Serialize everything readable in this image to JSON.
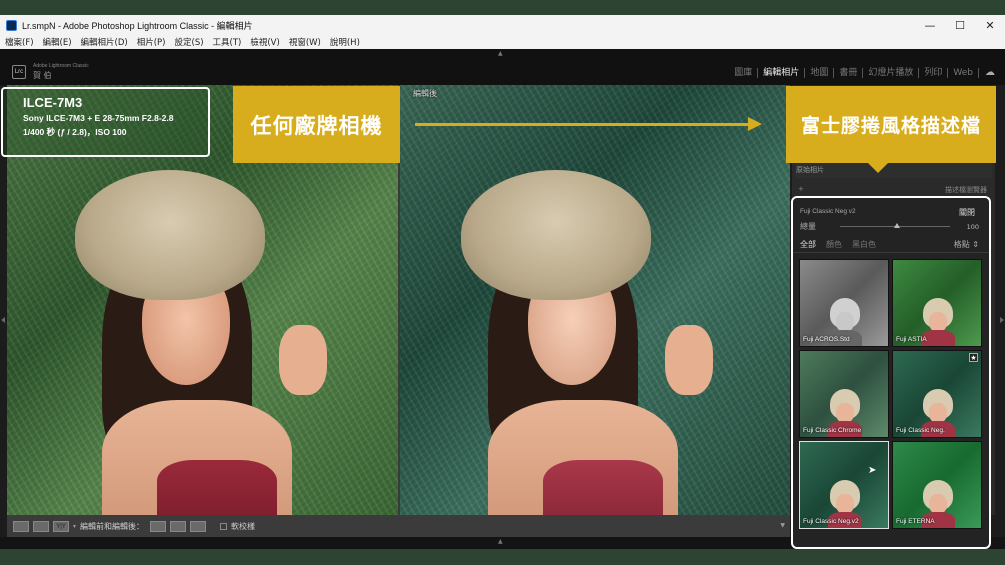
{
  "window": {
    "title": "Lr.smpN - Adobe Photoshop Lightroom Classic - 編輯相片",
    "minimize": "—",
    "maximize": "☐",
    "close": "✕"
  },
  "menu": [
    "檔案(F)",
    "編輯(E)",
    "編輯相片(D)",
    "相片(P)",
    "設定(S)",
    "工具(T)",
    "檢視(V)",
    "視窗(W)",
    "說明(H)"
  ],
  "identity": {
    "badge": "Lrc",
    "product": "Adobe Lightroom Classic",
    "user": "賀 伯"
  },
  "modules": [
    "圖庫",
    "編輯相片",
    "地圖",
    "書冊",
    "幻燈片播放",
    "列印",
    "Web"
  ],
  "active_module": "編輯相片",
  "compare": {
    "after_label": "編輯後"
  },
  "overlay": {
    "camera": "ILCE-7M3",
    "lens": "Sony ILCE-7M3 + E 28-75mm F2.8-2.8",
    "exposure": "1/400 秒 (ƒ / 2.8)，ISO 100",
    "banner_left": "任何廠牌相機",
    "banner_right": "富士膠捲風格描述檔"
  },
  "right_panel": {
    "original_photo": "原始相片",
    "plus": "+",
    "row_label": "描述檔瀏覽器"
  },
  "profile_browser": {
    "profile_name": "Fuji Classic Neg v2",
    "close_label": "關閉",
    "amount_label": "總量",
    "amount_value": "100",
    "tabs": [
      "全部",
      "顏色",
      "黑白色"
    ],
    "active_tab": "全部",
    "view_label": "格點",
    "thumbnails": [
      {
        "label": "Fuji ACROS.Std",
        "style": "gray"
      },
      {
        "label": "Fuji ASTIA",
        "style": "green"
      },
      {
        "label": "Fuji Classic Chrome",
        "style": "muted"
      },
      {
        "label": "Fuji Classic Neg.",
        "style": "teal"
      },
      {
        "label": "Fuji Classic Neg.v2",
        "style": "teal",
        "selected": true
      },
      {
        "label": "Fuji ETERNA",
        "style": "green"
      }
    ],
    "favorite_star": "★"
  },
  "toolbar": {
    "yy_label": "Y|Y",
    "compare_label": "編輯前和編輯後：",
    "soft_proof": "軟校樣"
  },
  "colors": {
    "banner": "#d8ad1d",
    "lr_dark": "#1c1c1c"
  }
}
